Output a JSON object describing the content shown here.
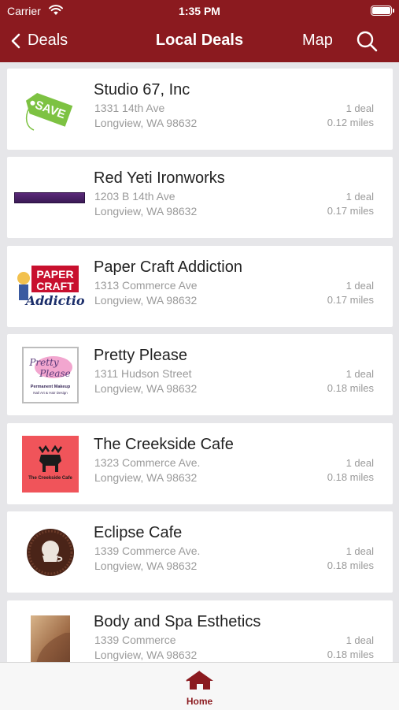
{
  "status_bar": {
    "carrier": "Carrier",
    "time": "1:35 PM"
  },
  "nav": {
    "back_label": "Deals",
    "title": "Local Deals",
    "map_label": "Map"
  },
  "colors": {
    "brand": "#8b1a1f",
    "background": "#e6e6e9"
  },
  "listings": [
    {
      "name": "Studio 67, Inc",
      "street": "1331 14th Ave",
      "city": "Longview, WA 98632",
      "deals": "1 deal",
      "distance": "0.12 miles"
    },
    {
      "name": "Red Yeti Ironworks",
      "street": "1203 B 14th Ave",
      "city": "Longview, WA 98632",
      "deals": "1 deal",
      "distance": "0.17 miles"
    },
    {
      "name": "Paper Craft Addiction",
      "street": "1313 Commerce Ave",
      "city": "Longview, WA 98632",
      "deals": "1 deal",
      "distance": "0.17 miles"
    },
    {
      "name": "Pretty Please",
      "street": "1311 Hudson Street",
      "city": "Longview, WA 98632",
      "deals": "1 deal",
      "distance": "0.18 miles"
    },
    {
      "name": "The Creekside Cafe",
      "street": "1323 Commerce Ave.",
      "city": "Longview, WA 98632",
      "deals": "1 deal",
      "distance": "0.18 miles"
    },
    {
      "name": "Eclipse Cafe",
      "street": "1339 Commerce Ave.",
      "city": "Longview, WA 98632",
      "deals": "1 deal",
      "distance": "0.18 miles"
    },
    {
      "name": "Body and Spa Esthetics",
      "street": "1339 Commerce",
      "city": "Longview, WA 98632",
      "deals": "1 deal",
      "distance": "0.18 miles"
    }
  ],
  "logos": {
    "studio67": "SAVE",
    "papercraft": [
      "PAPER",
      "CRAFT",
      "Addiction"
    ],
    "prettyplease": [
      "Pretty",
      "Please",
      "Permanent Makeup",
      "Nail Art & Hair Design"
    ],
    "creekside": "The Creekside Cafe"
  },
  "tab_bar": {
    "home_label": "Home"
  }
}
